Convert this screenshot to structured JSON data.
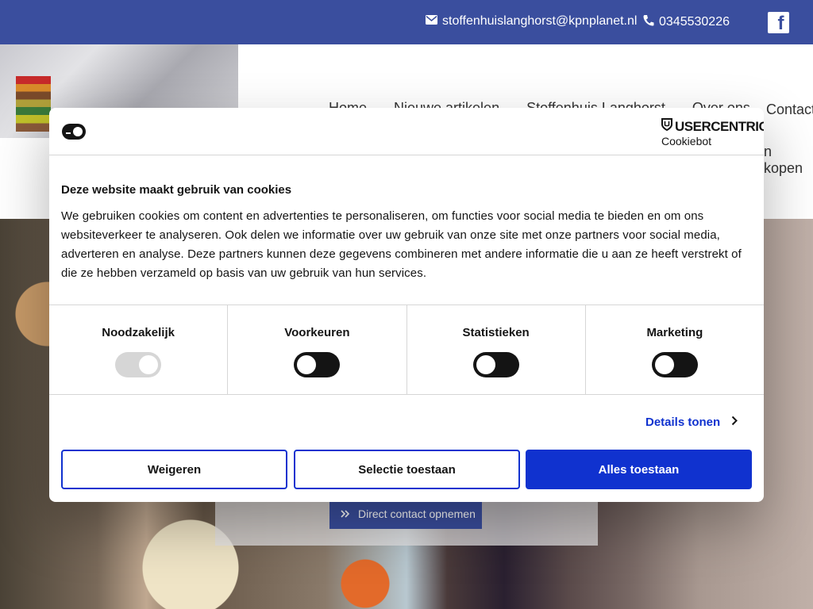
{
  "topbar": {
    "email": "stoffenhuislanghorst@kpnplanet.nl",
    "phone": "0345530226",
    "email_icon": "envelope-icon",
    "phone_icon": "phone-icon",
    "social_icon": "facebook-icon"
  },
  "nav": {
    "items": [
      "Home",
      "Nieuwe artikelen",
      "Stoffenhuis Langhorst",
      "Over ons"
    ],
    "contact": "Contact",
    "kopen": "n kopen"
  },
  "hero": {
    "button_label": "Direct contact opnemen",
    "button_icon": "double-chevron-right-icon"
  },
  "cookie_dialog": {
    "logo_icon": "cookie-consent-icon",
    "brand": "USERCENTRICS",
    "brand_sub": "Cookiebot",
    "title": "Deze website maakt gebruik van cookies",
    "body": "We gebruiken cookies om content en advertenties te personaliseren, om functies voor social media te bieden en om ons websiteverkeer te analyseren. Ook delen we informatie over uw gebruik van onze site met onze partners voor social media, adverteren en analyse. Deze partners kunnen deze gegevens combineren met andere informatie die u aan ze heeft verstrekt of die ze hebben verzameld op basis van uw gebruik van hun services.",
    "categories": [
      {
        "label": "Noodzakelijk",
        "enabled": true,
        "disabled": true
      },
      {
        "label": "Voorkeuren",
        "enabled": false,
        "disabled": false
      },
      {
        "label": "Statistieken",
        "enabled": false,
        "disabled": false
      },
      {
        "label": "Marketing",
        "enabled": false,
        "disabled": false
      }
    ],
    "details_label": "Details tonen",
    "buttons": {
      "deny": "Weigeren",
      "selection": "Selectie toestaan",
      "allow_all": "Alles toestaan"
    },
    "colors": {
      "accent": "#1032cf",
      "topbar": "#3a4e9e"
    }
  }
}
